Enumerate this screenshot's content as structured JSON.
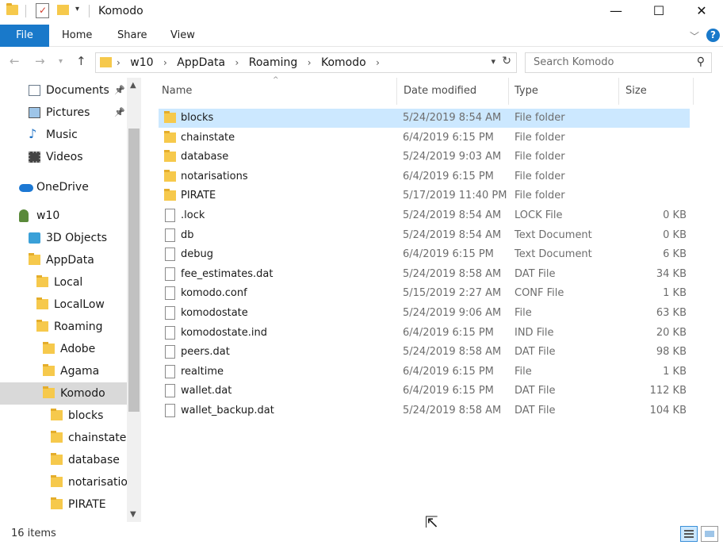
{
  "window": {
    "title": "Komodo"
  },
  "ribbon": {
    "tabs": [
      "File",
      "Home",
      "Share",
      "View"
    ],
    "help_label": "?"
  },
  "address": {
    "crumbs": [
      "w10",
      "AppData",
      "Roaming",
      "Komodo"
    ],
    "search_placeholder": "Search Komodo"
  },
  "nav": {
    "items": [
      {
        "label": "Documents",
        "icon": "documents-icon",
        "pinned": true
      },
      {
        "label": "Pictures",
        "icon": "pictures-icon",
        "pinned": true
      },
      {
        "label": "Music",
        "icon": "music-icon"
      },
      {
        "label": "Videos",
        "icon": "videos-icon"
      },
      {
        "label": "OneDrive",
        "icon": "onedrive-icon"
      },
      {
        "label": "w10",
        "icon": "user-icon"
      },
      {
        "label": "3D Objects",
        "icon": "3d-objects-icon"
      },
      {
        "label": "AppData",
        "icon": "folder-icon"
      },
      {
        "label": "Local",
        "icon": "folder-icon"
      },
      {
        "label": "LocalLow",
        "icon": "folder-icon"
      },
      {
        "label": "Roaming",
        "icon": "folder-icon"
      },
      {
        "label": "Adobe",
        "icon": "folder-icon"
      },
      {
        "label": "Agama",
        "icon": "folder-icon"
      },
      {
        "label": "Komodo",
        "icon": "folder-icon",
        "selected": true
      },
      {
        "label": "blocks",
        "icon": "folder-icon"
      },
      {
        "label": "chainstate",
        "icon": "folder-icon"
      },
      {
        "label": "database",
        "icon": "folder-icon"
      },
      {
        "label": "notarisation",
        "icon": "folder-icon"
      },
      {
        "label": "PIRATE",
        "icon": "folder-icon"
      }
    ]
  },
  "list": {
    "columns": [
      "Name",
      "Date modified",
      "Type",
      "Size"
    ],
    "rows": [
      {
        "name": "blocks",
        "date": "5/24/2019 8:54 AM",
        "type": "File folder",
        "size": "",
        "kind": "folder",
        "selected": true
      },
      {
        "name": "chainstate",
        "date": "6/4/2019 6:15 PM",
        "type": "File folder",
        "size": "",
        "kind": "folder"
      },
      {
        "name": "database",
        "date": "5/24/2019 9:03 AM",
        "type": "File folder",
        "size": "",
        "kind": "folder"
      },
      {
        "name": "notarisations",
        "date": "6/4/2019 6:15 PM",
        "type": "File folder",
        "size": "",
        "kind": "folder"
      },
      {
        "name": "PIRATE",
        "date": "5/17/2019 11:40 PM",
        "type": "File folder",
        "size": "",
        "kind": "folder"
      },
      {
        "name": ".lock",
        "date": "5/24/2019 8:54 AM",
        "type": "LOCK File",
        "size": "0 KB",
        "kind": "file"
      },
      {
        "name": "db",
        "date": "5/24/2019 8:54 AM",
        "type": "Text Document",
        "size": "0 KB",
        "kind": "file"
      },
      {
        "name": "debug",
        "date": "6/4/2019 6:15 PM",
        "type": "Text Document",
        "size": "6 KB",
        "kind": "file"
      },
      {
        "name": "fee_estimates.dat",
        "date": "5/24/2019 8:58 AM",
        "type": "DAT File",
        "size": "34 KB",
        "kind": "file"
      },
      {
        "name": "komodo.conf",
        "date": "5/15/2019 2:27 AM",
        "type": "CONF File",
        "size": "1 KB",
        "kind": "file"
      },
      {
        "name": "komodostate",
        "date": "5/24/2019 9:06 AM",
        "type": "File",
        "size": "63 KB",
        "kind": "file"
      },
      {
        "name": "komodostate.ind",
        "date": "6/4/2019 6:15 PM",
        "type": "IND File",
        "size": "20 KB",
        "kind": "file"
      },
      {
        "name": "peers.dat",
        "date": "5/24/2019 8:58 AM",
        "type": "DAT File",
        "size": "98 KB",
        "kind": "file"
      },
      {
        "name": "realtime",
        "date": "6/4/2019 6:15 PM",
        "type": "File",
        "size": "1 KB",
        "kind": "file"
      },
      {
        "name": "wallet.dat",
        "date": "6/4/2019 6:15 PM",
        "type": "DAT File",
        "size": "112 KB",
        "kind": "file"
      },
      {
        "name": "wallet_backup.dat",
        "date": "5/24/2019 8:58 AM",
        "type": "DAT File",
        "size": "104 KB",
        "kind": "file"
      }
    ]
  },
  "status": {
    "item_count": "16 items"
  },
  "colors": {
    "accent": "#1979ca",
    "selection": "#cce8ff",
    "folder": "#f6c94c"
  }
}
